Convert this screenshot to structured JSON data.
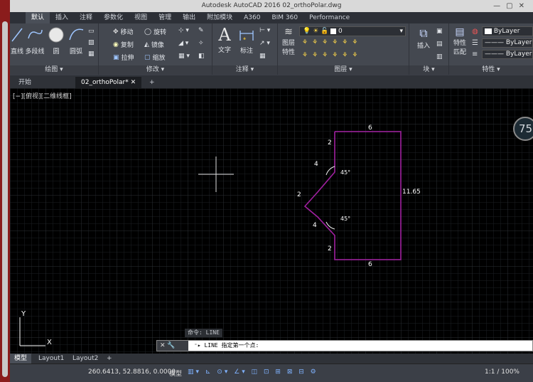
{
  "window": {
    "title": "Autodesk AutoCAD 2016    02_orthoPolar.dwg"
  },
  "ribbon_tabs": [
    "默认",
    "插入",
    "注释",
    "参数化",
    "视图",
    "管理",
    "输出",
    "附加模块",
    "A360",
    "BIM 360",
    "Performance"
  ],
  "draw_panel": {
    "title": "绘图",
    "line": "直线",
    "polyline": "多段线",
    "circle": "圆",
    "arc": "圆弧"
  },
  "modify_panel": {
    "title": "修改",
    "move": "移动",
    "rotate": "旋转",
    "copy": "复制",
    "mirror": "镜像",
    "stretch": "拉伸",
    "scale": "缩放"
  },
  "annotation_panel": {
    "title": "注释",
    "text": "文字",
    "dimension": "标注"
  },
  "layers_panel": {
    "title": "图层",
    "layer_props": "图层",
    "layer_props2": "特性",
    "current_layer": "0"
  },
  "block_panel": {
    "title": "块",
    "insert": "插入"
  },
  "properties_panel": {
    "title": "特性",
    "match": "特性",
    "match2": "匹配",
    "color": "ByLayer",
    "linetype": "ByLayer",
    "lineweight": "ByLayer"
  },
  "doc_tabs": {
    "start": "开始",
    "current": "02_orthoPolar*"
  },
  "viewport": {
    "label": "[−][俯视][二维线框]",
    "navwheel": "75"
  },
  "drawing": {
    "dims": {
      "top": "6",
      "bottom": "6",
      "right": "11.65",
      "upper_small": "2",
      "lower_small": "2",
      "left_small": "2",
      "upper_diag": "4",
      "lower_diag": "4"
    },
    "angles": {
      "upper": "45°",
      "lower": "45°"
    },
    "line_color": "#a020a0"
  },
  "ucs": {
    "x": "X",
    "y": "Y"
  },
  "command": {
    "history": "命令:  LINE",
    "prompt": "LINE 指定第一个点:"
  },
  "layout_tabs": {
    "model": "模型",
    "layout1": "Layout1",
    "layout2": "Layout2"
  },
  "status": {
    "coords": "260.6413, 52.8816, 0.0000",
    "model": "模型",
    "scale": "1:1 / 100%"
  }
}
